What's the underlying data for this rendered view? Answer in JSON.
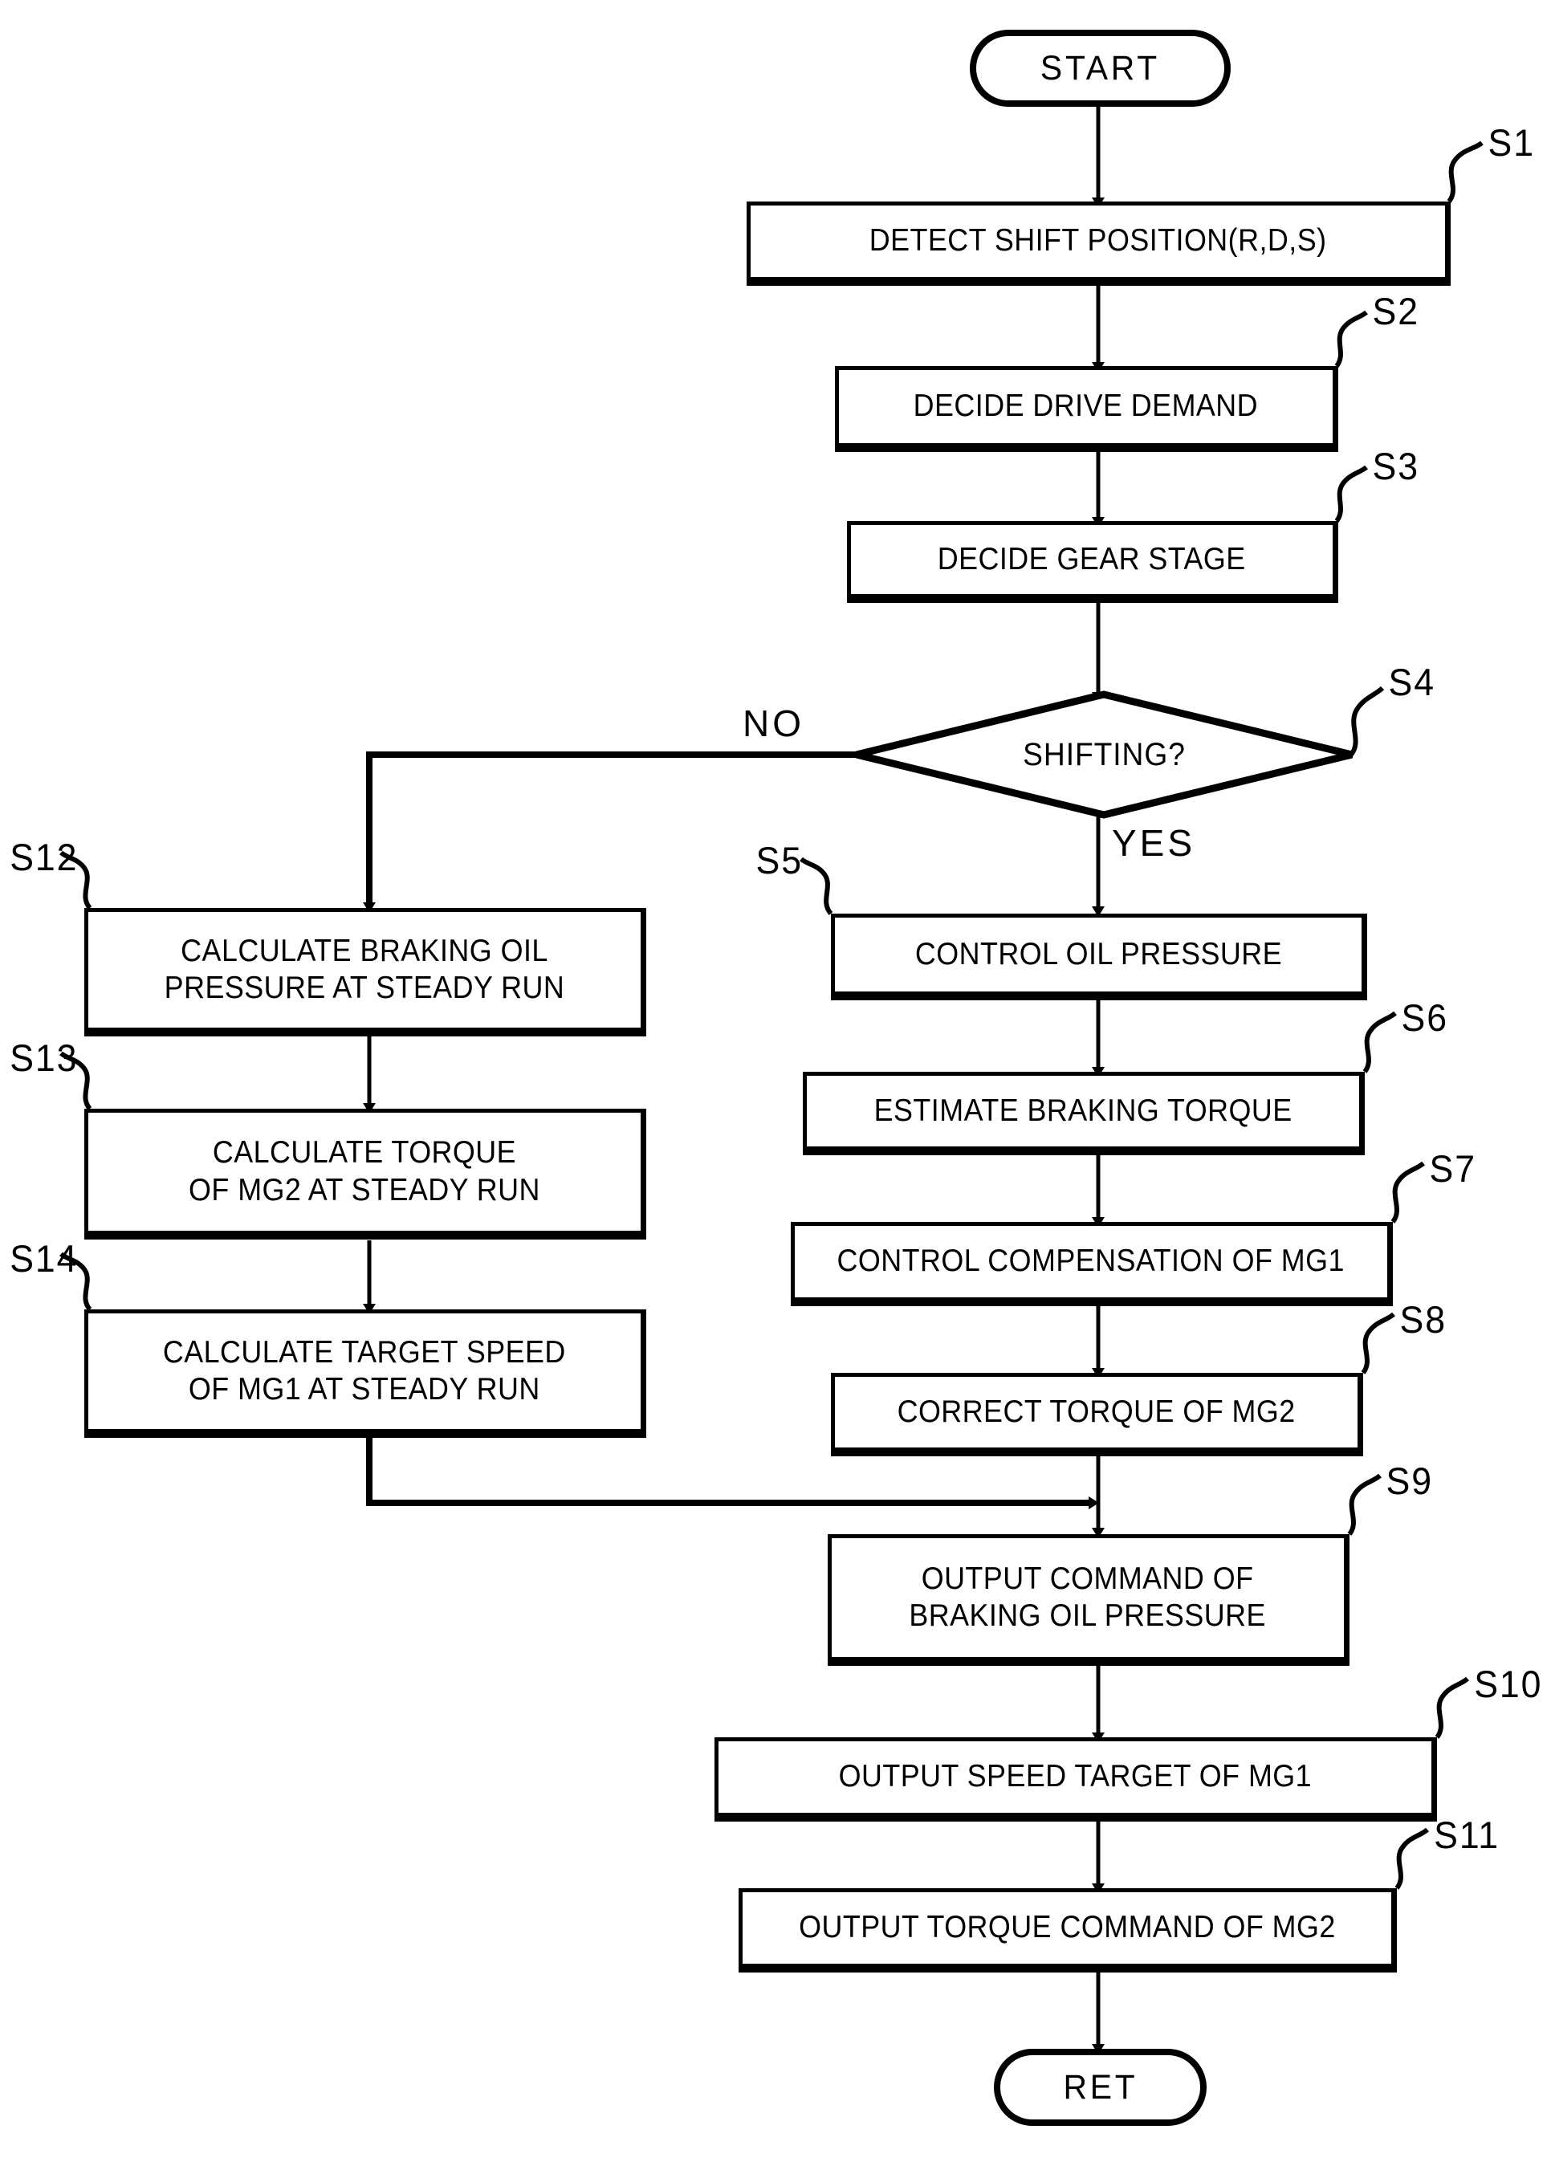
{
  "diagram": {
    "title": "Flowchart of shift control routine",
    "ink_color": "#000000",
    "background_color": "#ffffff",
    "start": {
      "label": "START"
    },
    "end": {
      "label": "RET"
    },
    "decision": {
      "step": "S4",
      "label": "SHIFTING?"
    },
    "branch_labels": {
      "no": "NO",
      "yes": "YES"
    },
    "steps": [
      {
        "id": "S1",
        "tag": "S1",
        "label": "DETECT SHIFT POSITION(R,D,S)"
      },
      {
        "id": "S2",
        "tag": "S2",
        "label": "DECIDE DRIVE DEMAND"
      },
      {
        "id": "S3",
        "tag": "S3",
        "label": "DECIDE GEAR STAGE"
      },
      {
        "id": "S5",
        "tag": "S5",
        "label": "CONTROL OIL PRESSURE"
      },
      {
        "id": "S6",
        "tag": "S6",
        "label": "ESTIMATE BRAKING TORQUE"
      },
      {
        "id": "S7",
        "tag": "S7",
        "label": "CONTROL COMPENSATION OF MG1"
      },
      {
        "id": "S8",
        "tag": "S8",
        "label": "CORRECT TORQUE OF MG2"
      },
      {
        "id": "S9",
        "tag": "S9",
        "label": "OUTPUT COMMAND OF\nBRAKING OIL PRESSURE"
      },
      {
        "id": "S10",
        "tag": "S10",
        "label": "OUTPUT SPEED TARGET OF MG1"
      },
      {
        "id": "S11",
        "tag": "S11",
        "label": "OUTPUT TORQUE COMMAND OF MG2"
      },
      {
        "id": "S12",
        "tag": "S12",
        "label": "CALCULATE BRAKING OIL\nPRESSURE AT STEADY RUN"
      },
      {
        "id": "S13",
        "tag": "S13",
        "label": "CALCULATE TORQUE\nOF MG2  AT STEADY RUN"
      },
      {
        "id": "S14",
        "tag": "S14",
        "label": "CALCULATE TARGET SPEED\nOF MG1 AT STEADY RUN"
      }
    ]
  }
}
